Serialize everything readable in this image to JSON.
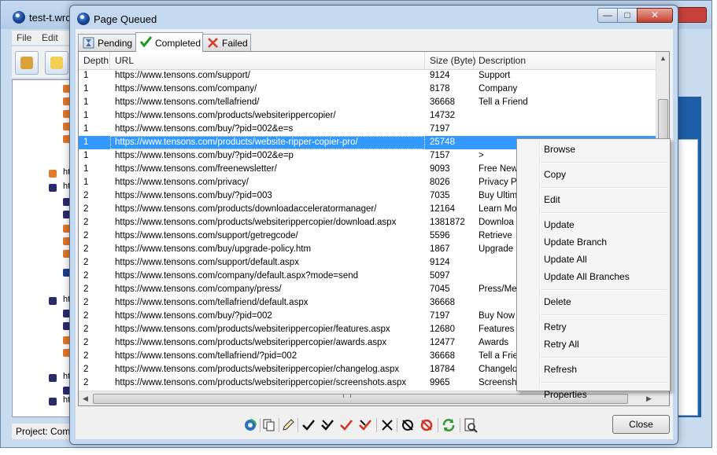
{
  "background_window": {
    "title": "test-t.wrc",
    "menu": [
      "File",
      "Edit"
    ],
    "status": "Project: Com",
    "tree_labels": [
      "htt",
      "htt",
      "htt",
      "htt",
      "htt"
    ]
  },
  "dialog": {
    "title": "Page Queued",
    "close_label": "Close",
    "tabs": [
      {
        "label": "Pending"
      },
      {
        "label": "Completed"
      },
      {
        "label": "Failed"
      }
    ],
    "columns": {
      "depth": "Depth",
      "url": "URL",
      "size": "Size (Byte)",
      "description": "Description"
    },
    "rows": [
      {
        "depth": "1",
        "url": "https://www.tensons.com/support/",
        "size": "9124",
        "description": "Support"
      },
      {
        "depth": "1",
        "url": "https://www.tensons.com/company/",
        "size": "8178",
        "description": "Company"
      },
      {
        "depth": "1",
        "url": "https://www.tensons.com/tellafriend/",
        "size": "36668",
        "description": "Tell a Friend"
      },
      {
        "depth": "1",
        "url": "https://www.tensons.com/products/websiterippercopier/",
        "size": "14732",
        "description": ""
      },
      {
        "depth": "1",
        "url": "https://www.tensons.com/buy/?pid=002&e=s",
        "size": "7197",
        "description": ""
      },
      {
        "depth": "1",
        "url": "https://www.tensons.com/products/website-ripper-copier-pro/",
        "size": "25748",
        "description": "",
        "selected": true
      },
      {
        "depth": "1",
        "url": "https://www.tensons.com/buy/?pid=002&e=p",
        "size": "7157",
        "description": ">"
      },
      {
        "depth": "1",
        "url": "https://www.tensons.com/freenewsletter/",
        "size": "9093",
        "description": "Free New"
      },
      {
        "depth": "1",
        "url": "https://www.tensons.com/privacy/",
        "size": "8026",
        "description": "Privacy P"
      },
      {
        "depth": "2",
        "url": "https://www.tensons.com/buy/?pid=003",
        "size": "7035",
        "description": "Buy Ultim"
      },
      {
        "depth": "2",
        "url": "https://www.tensons.com/products/downloadacceleratormanager/",
        "size": "12164",
        "description": "Learn Mo"
      },
      {
        "depth": "2",
        "url": "https://www.tensons.com/products/websiterippercopier/download.aspx",
        "size": "1381872",
        "description": "Downloa"
      },
      {
        "depth": "2",
        "url": "https://www.tensons.com/support/getregcode/",
        "size": "5596",
        "description": "Retrieve"
      },
      {
        "depth": "2",
        "url": "https://www.tensons.com/buy/upgrade-policy.htm",
        "size": "1867",
        "description": "Upgrade"
      },
      {
        "depth": "2",
        "url": "https://www.tensons.com/support/default.aspx",
        "size": "9124",
        "description": ""
      },
      {
        "depth": "2",
        "url": "https://www.tensons.com/company/default.aspx?mode=send",
        "size": "5097",
        "description": ""
      },
      {
        "depth": "2",
        "url": "https://www.tensons.com/company/press/",
        "size": "7045",
        "description": "Press/Me"
      },
      {
        "depth": "2",
        "url": "https://www.tensons.com/tellafriend/default.aspx",
        "size": "36668",
        "description": ""
      },
      {
        "depth": "2",
        "url": "https://www.tensons.com/buy/?pid=002",
        "size": "7197",
        "description": "Buy Now"
      },
      {
        "depth": "2",
        "url": "https://www.tensons.com/products/websiterippercopier/features.aspx",
        "size": "12680",
        "description": "Features"
      },
      {
        "depth": "2",
        "url": "https://www.tensons.com/products/websiterippercopier/awards.aspx",
        "size": "12477",
        "description": "Awards"
      },
      {
        "depth": "2",
        "url": "https://www.tensons.com/tellafriend/?pid=002",
        "size": "36668",
        "description": "Tell a Frie"
      },
      {
        "depth": "2",
        "url": "https://www.tensons.com/products/websiterippercopier/changelog.aspx",
        "size": "18784",
        "description": "Changelo"
      },
      {
        "depth": "2",
        "url": "https://www.tensons.com/products/websiterippercopier/screenshots.aspx",
        "size": "9965",
        "description": "Screensh"
      }
    ]
  },
  "context_menu": {
    "groups": [
      [
        "Browse"
      ],
      [
        "Copy"
      ],
      [
        "Edit"
      ],
      [
        "Update",
        "Update Branch",
        "Update All",
        "Update All Branches"
      ],
      [
        "Delete"
      ],
      [
        "Retry",
        "Retry All"
      ],
      [
        "Refresh"
      ],
      [
        "Properties"
      ]
    ]
  },
  "toolbar_icons": [
    "browse-icon",
    "copy-icon",
    "edit-icon",
    "check-icon",
    "check-branch-icon",
    "check-all-icon",
    "check-all-branches-icon",
    "delete-icon",
    "retry-icon",
    "retry-all-icon",
    "refresh-icon",
    "properties-icon"
  ],
  "colors": {
    "selection": "#3399ff",
    "title_bar": "#c4d9ef",
    "client": "#f0f0f0"
  }
}
